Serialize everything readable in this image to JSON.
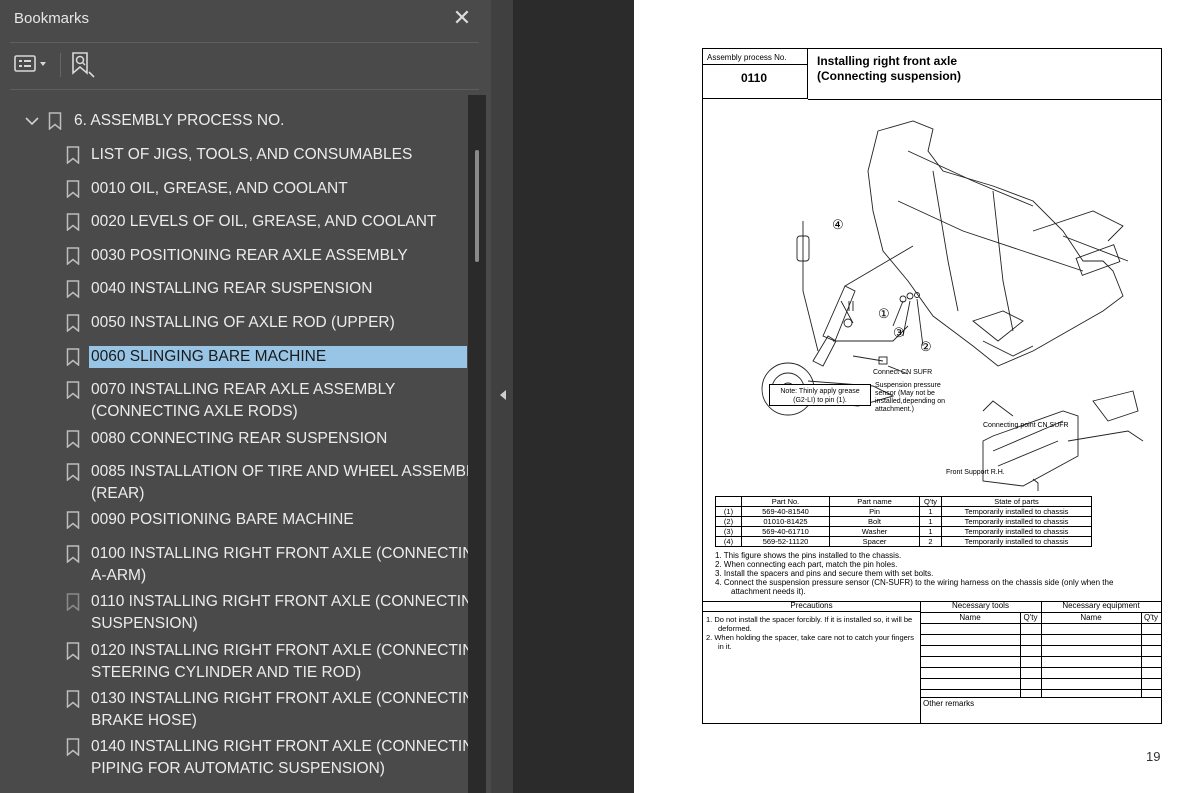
{
  "panel": {
    "title": "Bookmarks",
    "close_glyph": "✕"
  },
  "toolbar": {
    "options_icon": "list-options-icon",
    "find_bookmark_icon": "find-bookmark-icon"
  },
  "tree": {
    "parent": {
      "label": "6. ASSEMBLY PROCESS NO.",
      "expanded": true
    },
    "items": [
      {
        "label": "LIST OF JIGS, TOOLS, AND CONSUMABLES"
      },
      {
        "label": "0010 OIL, GREASE, AND COOLANT"
      },
      {
        "label": "0020 LEVELS OF OIL, GREASE, AND COOLANT"
      },
      {
        "label": "0030 POSITIONING REAR AXLE ASSEMBLY"
      },
      {
        "label": "0040 INSTALLING REAR SUSPENSION"
      },
      {
        "label": "0050 INSTALLING OF AXLE ROD (UPPER)"
      },
      {
        "label": "0060 SLINGING BARE MACHINE",
        "selected": true
      },
      {
        "line1": "0070 INSTALLING REAR AXLE ASSEMBLY",
        "line2": "(CONNECTING AXLE RODS)"
      },
      {
        "label": "0080 CONNECTING REAR SUSPENSION"
      },
      {
        "line1": "0085 INSTALLATION OF TIRE AND WHEEL ASSEMBLY",
        "line2": "(REAR)"
      },
      {
        "label": "0090 POSITIONING BARE MACHINE"
      },
      {
        "line1": "0100 INSTALLING RIGHT FRONT AXLE (CONNECTING",
        "line2": "A-ARM)"
      },
      {
        "line1": "0110 INSTALLING RIGHT FRONT AXLE (CONNECTING",
        "line2": "SUSPENSION)"
      },
      {
        "line1": "0120 INSTALLING RIGHT FRONT AXLE (CONNECTING",
        "line2": "STEERING CYLINDER AND TIE ROD)"
      },
      {
        "line1": "0130 INSTALLING RIGHT FRONT AXLE (CONNECTING",
        "line2": "BRAKE HOSE)"
      },
      {
        "line1": "0140 INSTALLING RIGHT FRONT AXLE (CONNECTING",
        "line2": "PIPING FOR AUTOMATIC SUSPENSION)"
      }
    ]
  },
  "document": {
    "assembly_label": "Assembly process No.",
    "assembly_no": "0110",
    "title_line1": "Installing right front axle",
    "title_line2": "(Connecting suspension)",
    "callouts": {
      "c1": "①",
      "c2": "②",
      "c3": "③",
      "c4": "④",
      "connect": "Connect CN SUFR",
      "sensor1": "Suspension pressure",
      "sensor2": "sensor (May not be",
      "sensor3": "installed,depending on",
      "sensor4": "attachment.)",
      "connecting_point": "Connecting point CN SUFR",
      "front_support": "Front Support R.H.",
      "note1": "Note: Thinly apply grease",
      "note2": "(G2-LI) to pin (1)."
    },
    "parts_headers": [
      "",
      "Part No.",
      "Part name",
      "Q'ty",
      "State of parts"
    ],
    "parts": [
      [
        "(1)",
        "569-40-81540",
        "Pin",
        "1",
        "Temporarily installed to chassis"
      ],
      [
        "(2)",
        "01010-81425",
        "Bolt",
        "1",
        "Temporarily installed to chassis"
      ],
      [
        "(3)",
        "569-40-61710",
        "Washer",
        "1",
        "Temporarily installed to chassis"
      ],
      [
        "(4)",
        "569-52-11120",
        "Spacer",
        "2",
        "Temporarily installed to chassis"
      ]
    ],
    "notes": [
      "1.  This figure shows the pins installed to the chassis.",
      "2.  When connecting each part, match the pin holes.",
      "3.  Install the spacers and pins and secure them with set bolts.",
      "4.  Connect the suspension pressure sensor (CN-SUFR) to the wiring harness on the chassis side (only when the attachment needs it)."
    ],
    "precautions_header": "Precautions",
    "precautions": [
      "1.  Do not install the spacer forcibly.  If it is installed so, it will be deformed.",
      "2.  When holding the spacer, take care not to catch your fingers in it."
    ],
    "tools_header": "Necessary tools",
    "equipment_header": "Necessary equipment",
    "name_label": "Name",
    "qty_label": "Q'ty",
    "other_remarks": "Other remarks",
    "page_number": "19"
  }
}
